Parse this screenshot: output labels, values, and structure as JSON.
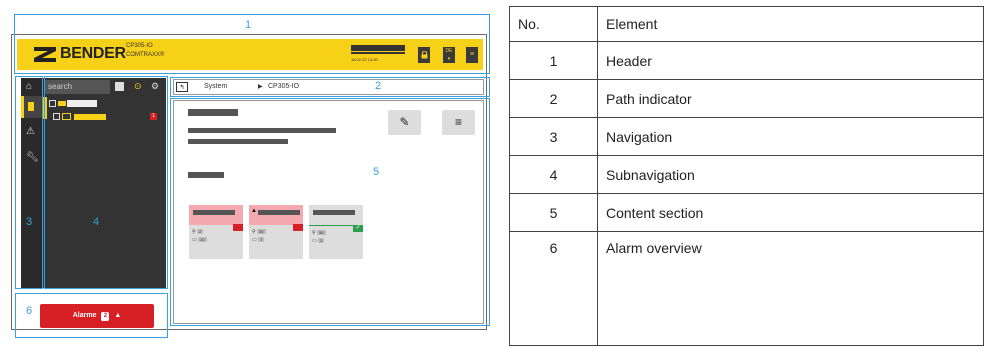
{
  "ui": {
    "logo_text": "BENDER",
    "product_line1": "CP305-IO",
    "product_line2": "COMTRAXX®",
    "datetime": "18.02.22 13:30",
    "lang": "DE",
    "search_placeholder": "search",
    "path_system": "System",
    "path_device": "CP305-IO",
    "alarm_label": "Alarme",
    "alarm_count": "2",
    "tree_badge": "1",
    "card1": {
      "v1": "2",
      "v2": "10"
    },
    "card2": {
      "v1": "30",
      "v2": "7"
    },
    "card3": {
      "v1": "50",
      "v2": "2"
    }
  },
  "callouts": [
    "1",
    "2",
    "3",
    "4",
    "5",
    "6"
  ],
  "table": {
    "col_no": "No.",
    "col_element": "Element",
    "rows": [
      {
        "no": "1",
        "element": "Header"
      },
      {
        "no": "2",
        "element": "Path indicator"
      },
      {
        "no": "3",
        "element": "Navigation"
      },
      {
        "no": "4",
        "element": "Subnavigation"
      },
      {
        "no": "5",
        "element": "Content section"
      },
      {
        "no": "6",
        "element": "Alarm overview"
      }
    ]
  },
  "colors": {
    "brand_yellow": "#f7d117",
    "alarm_red": "#d71f26",
    "callout_blue": "#3aa0dc",
    "sidebar_dark": "#333333"
  }
}
